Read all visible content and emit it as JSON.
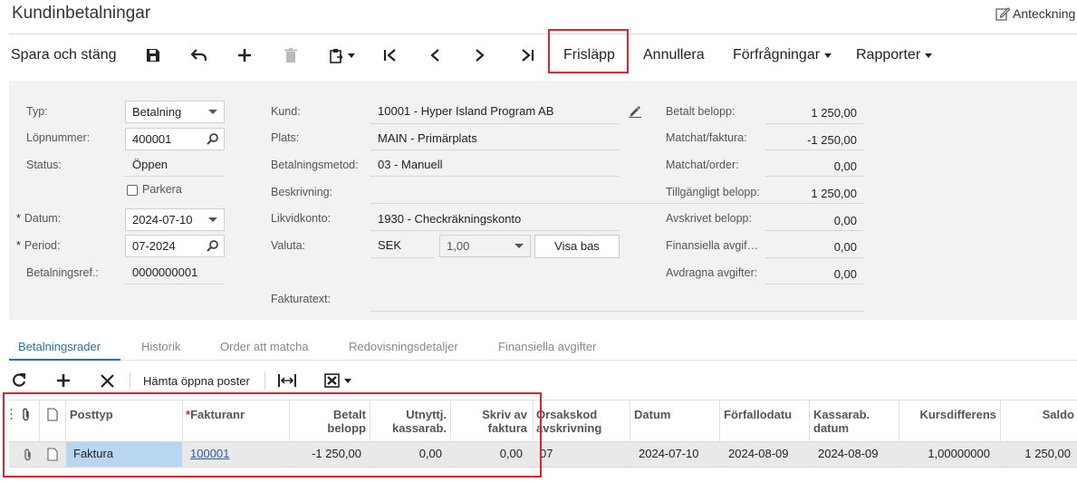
{
  "page": {
    "title": "Kundinbetalningar",
    "notes_label": "Anteckning"
  },
  "toolbar": {
    "save_close": "Spara och stäng",
    "release": "Frisläpp",
    "cancel": "Annullera",
    "inquiries": "Förfrågningar",
    "reports": "Rapporter"
  },
  "form": {
    "left": {
      "type_label": "Typ:",
      "type_value": "Betalning",
      "number_label": "Löpnummer:",
      "number_value": "400001",
      "status_label": "Status:",
      "status_value": "Öppen",
      "hold_label": "Parkera",
      "date_label": "Datum:",
      "date_value": "2024-07-10",
      "period_label": "Period:",
      "period_value": "07-2024",
      "payment_ref_label": "Betalningsref.:",
      "payment_ref_value": "0000000001"
    },
    "middle": {
      "customer_label": "Kund:",
      "customer_value": "10001 - Hyper Island Program AB",
      "location_label": "Plats:",
      "location_value": "MAIN - Primärplats",
      "payment_method_label": "Betalningsmetod:",
      "payment_method_value": "03 - Manuell",
      "description_label": "Beskrivning:",
      "description_value": "",
      "cash_account_label": "Likvidkonto:",
      "cash_account_value": "1930 - Checkräkningskonto",
      "currency_label": "Valuta:",
      "currency_value": "SEK",
      "rate_value": "1,00",
      "show_base_button": "Visa bas",
      "invoice_text_label": "Fakturatext:"
    },
    "right": {
      "paid_amount_label": "Betalt belopp:",
      "paid_amount_value": "1 250,00",
      "applied_invoice_label": "Matchat/faktura:",
      "applied_invoice_value": "-1 250,00",
      "applied_order_label": "Matchat/order:",
      "applied_order_value": "0,00",
      "available_label": "Tillgängligt belopp:",
      "available_value": "1 250,00",
      "writeoff_label": "Avskrivet belopp:",
      "writeoff_value": "0,00",
      "finance_charges_label": "Finansiella avgif…",
      "finance_charges_value": "0,00",
      "deducted_charges_label": "Avdragna avgifter:",
      "deducted_charges_value": "0,00"
    }
  },
  "tabs": [
    "Betalningsrader",
    "Historik",
    "Order att matcha",
    "Redovisningsdetaljer",
    "Finansiella avgifter"
  ],
  "grid_toolbar": {
    "load_open": "Hämta öppna poster"
  },
  "grid": {
    "headers": {
      "posttyp": "Posttyp",
      "fakturanr": "Fakturanr",
      "betalt_1": "Betalt",
      "betalt_2": "belopp",
      "utnyttj_1": "Utnyttj.",
      "utnyttj_2": "kassarab.",
      "skriv_1": "Skriv av",
      "skriv_2": "faktura",
      "orsak_1": "Orsakskod",
      "orsak_2": "avskrivning",
      "datum": "Datum",
      "forfallo": "Förfallodatu",
      "kassarab_1": "Kassarab.",
      "kassarab_2": "datum",
      "kursdiff": "Kursdifferens",
      "saldo": "Saldo"
    },
    "row": {
      "posttyp": "Faktura",
      "fakturanr": "100001",
      "betalt": "-1 250,00",
      "utnyttj": "0,00",
      "skriv": "0,00",
      "orsak": "07",
      "datum": "2024-07-10",
      "forfallo": "2024-08-09",
      "kassarab": "2024-08-09",
      "kursdiff": "1,00000000",
      "saldo": "1 250,00"
    }
  }
}
